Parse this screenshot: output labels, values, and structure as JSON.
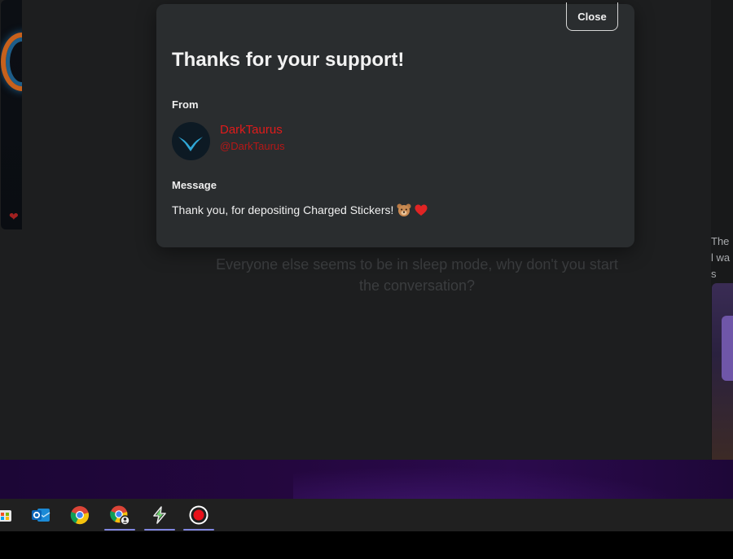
{
  "chat": {
    "empty_state": "Everyone else seems to be in sleep mode, why don't you start the conversation?"
  },
  "sidebar_right": {
    "caption": "The l was"
  },
  "modal": {
    "title": "Thanks for your support!",
    "close_label": "Close",
    "from_label": "From",
    "sender": {
      "name": "DarkTaurus",
      "handle": "@DarkTaurus"
    },
    "message_label": "Message",
    "message": "Thank you, for depositing Charged Stickers!",
    "message_emojis": [
      "bear-face",
      "red-heart"
    ]
  },
  "colors": {
    "sender_name": "#e01b1b",
    "modal_bg": "#2a2d2f",
    "page_bg": "#1d1e1f",
    "taskbar_active": "#7f86e0"
  },
  "taskbar": {
    "icons": [
      {
        "name": "store-icon",
        "active": false
      },
      {
        "name": "outlook-icon",
        "active": false
      },
      {
        "name": "chrome-icon",
        "active": false
      },
      {
        "name": "chrome-profile-icon",
        "active": true
      },
      {
        "name": "bolt-app-icon",
        "active": true
      },
      {
        "name": "record-icon",
        "active": true
      }
    ]
  }
}
